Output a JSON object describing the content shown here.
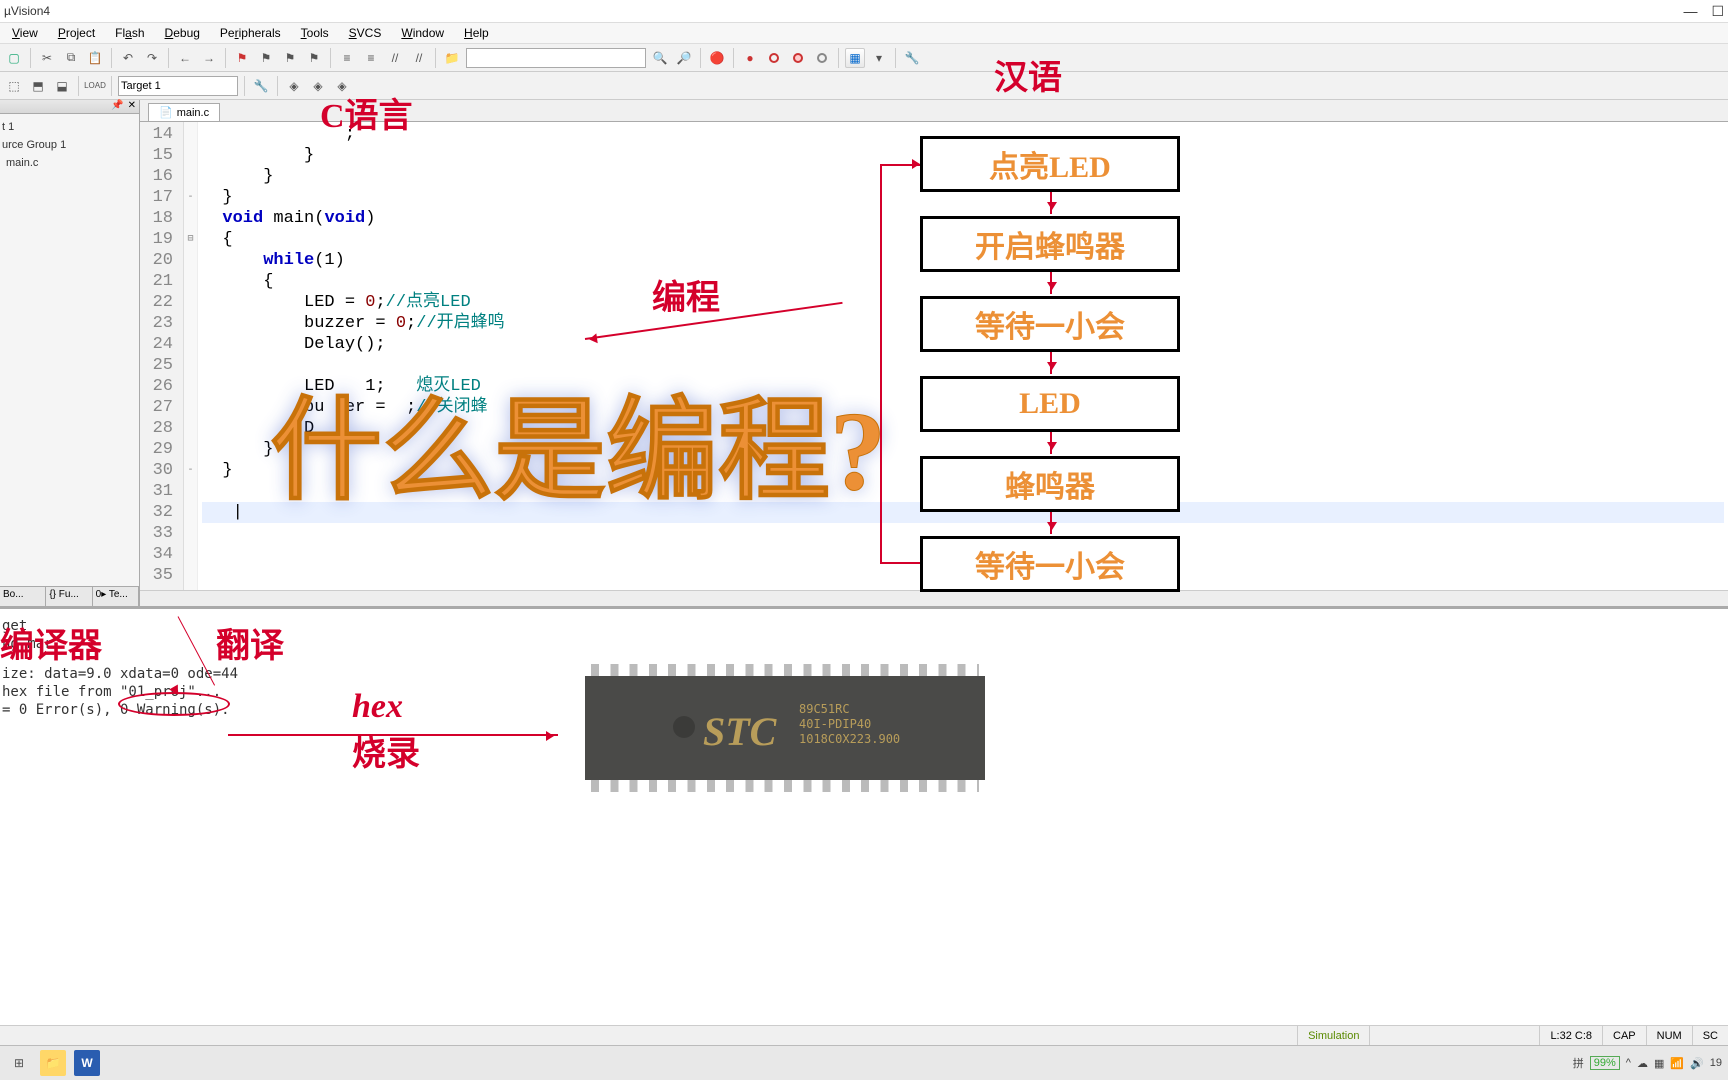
{
  "window": {
    "title": "µVision4"
  },
  "menu": {
    "view": "View",
    "project": "Project",
    "flash": "Flash",
    "debug": "Debug",
    "peripherals": "Peripherals",
    "tools": "Tools",
    "svcs": "SVCS",
    "window": "Window",
    "help": "Help"
  },
  "toolbar2": {
    "target": "Target 1"
  },
  "project_tree": {
    "item0": "t 1",
    "item1": "urce Group 1",
    "item2": "main.c"
  },
  "project_tabs": {
    "t0": "Bo...",
    "t1": "{} Fu...",
    "t2": "0▸ Te..."
  },
  "file_tab": {
    "name": "main.c"
  },
  "gutter": {
    "start": 14,
    "end": 35
  },
  "code": {
    "l14": "              ;",
    "l15": "          }",
    "l16": "      }",
    "l17": "  }",
    "l18_pre": "  ",
    "l18_kw": "void",
    "l18_mid": " main(",
    "l18_kw2": "void",
    "l18_post": ")",
    "l19": "  {",
    "l20_pre": "      ",
    "l20_kw": "while",
    "l20_post": "(1)",
    "l21": "      {",
    "l22_pre": "          LED = ",
    "l22_num": "0",
    "l22_post": ";",
    "l22_cmt": "//点亮LED",
    "l23_pre": "          buzzer = ",
    "l23_num": "0",
    "l23_post": ";",
    "l23_cmt": "//开启蜂鸣",
    "l24": "          Delay();",
    "l25": "",
    "l26_pre": "          LED   1;",
    "l26_cmt": "  熄灭LED",
    "l27_pre": "          bu  er =  ;",
    "l27_cmt": "//关闭蜂",
    "l28": "          D",
    "l29": "      }",
    "l30": "  }",
    "l31": "",
    "l32": "   |",
    "l33": "",
    "l34": "",
    "l35": ""
  },
  "output": {
    "l1": "get",
    "l2": "ng mar",
    "l3": "ize: data=9.0 xdata=0  ode=44",
    "l4": "hex file from \"01_proj\"...",
    "l5": "   = 0 Error(s), 0 Warning(s)."
  },
  "annotations": {
    "c_lang": "C语言",
    "hanyu": "汉语",
    "biancheng": "编程",
    "big": "什么是编程?",
    "compiler": "编译器",
    "translate": "翻译",
    "hex": "hex",
    "burn": "烧录"
  },
  "flow": {
    "b1": "点亮LED",
    "b2": "开启蜂鸣器",
    "b3": "等待一小会",
    "b4": "LED",
    "b5": "蜂鸣器",
    "b6": "等待一小会"
  },
  "chip": {
    "logo": "STC",
    "line1": "89C51RC",
    "line2": "40I-PDIP40",
    "line3": "1018C0X223.900"
  },
  "status": {
    "sim": "Simulation",
    "lc": "L:32 C:8",
    "caps": "CAP",
    "num": "NUM",
    "scroll": "SC"
  },
  "tray": {
    "ime": "拼",
    "battery": "99%",
    "time": "19"
  }
}
